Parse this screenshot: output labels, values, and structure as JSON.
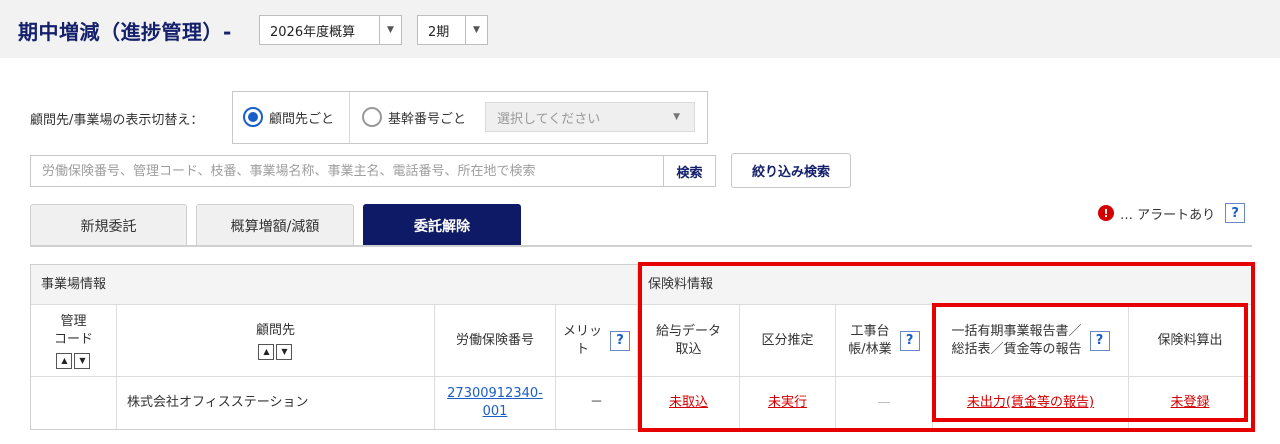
{
  "header": {
    "title": "期中増減（進捗管理）-",
    "year_select": "2026年度概算",
    "period_select": "2期"
  },
  "filter": {
    "mode_label": "顧問先/事業場の表示切替え：",
    "radio_client": "顧問先ごと",
    "radio_number": "基幹番号ごと",
    "select_placeholder": "選択してください",
    "search_placeholder": "労働保険番号、管理コード、枝番、事業場名称、事業主名、電話番号、所在地で検索",
    "search_button": "検索",
    "filter_button": "絞り込み検索"
  },
  "tabs": [
    "新規委託",
    "概算増額/減額",
    "委託解除"
  ],
  "alert": {
    "icon_char": "!",
    "label": "… アラートあり",
    "help": "?"
  },
  "table": {
    "group_office": "事業場情報",
    "group_premium": "保険料情報",
    "col_code": "管理\nコード",
    "col_client": "顧問先",
    "col_number": "労働保険番号",
    "col_merit": "メリッ\nト",
    "col_payroll": "給与データ\n取込",
    "col_category": "区分推定",
    "col_construction": "工事台\n帳/林業",
    "col_report": "一括有期事業報告書／\n総括表／賃金等の報告",
    "col_calc": "保険料算出",
    "help": "?",
    "sort_up": "▲",
    "sort_down": "▼",
    "rows": [
      {
        "code": "",
        "client": "株式会社オフィスステーション",
        "number_line1": "27300912340-",
        "number_line2": "001",
        "merit": "－",
        "payroll": "未取込",
        "category": "未実行",
        "construction": "—",
        "report": "未出力(賃金等の報告)",
        "calc": "未登録"
      }
    ]
  },
  "colors": {
    "accent_navy": "#14206b",
    "status_red": "#d40000",
    "link_blue": "#1a5ec8",
    "highlight": "#e60000"
  }
}
